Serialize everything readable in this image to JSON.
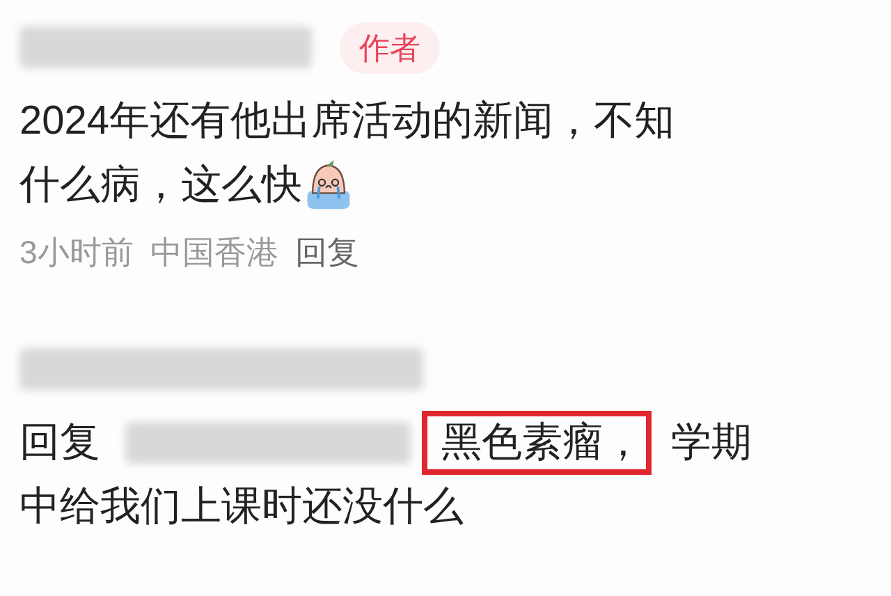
{
  "comments": [
    {
      "author_badge": "作者",
      "text_lines": [
        "2024年还有他出席活动的新闻，不知",
        "什么病，这么快"
      ],
      "meta": {
        "time": "3小时前",
        "location": "中国香港",
        "reply": "回复"
      }
    },
    {
      "reply_prefix": "回复",
      "highlighted": "黑色素瘤，",
      "text_lines": [
        "学期",
        "中给我们上课时还没什么"
      ]
    }
  ]
}
